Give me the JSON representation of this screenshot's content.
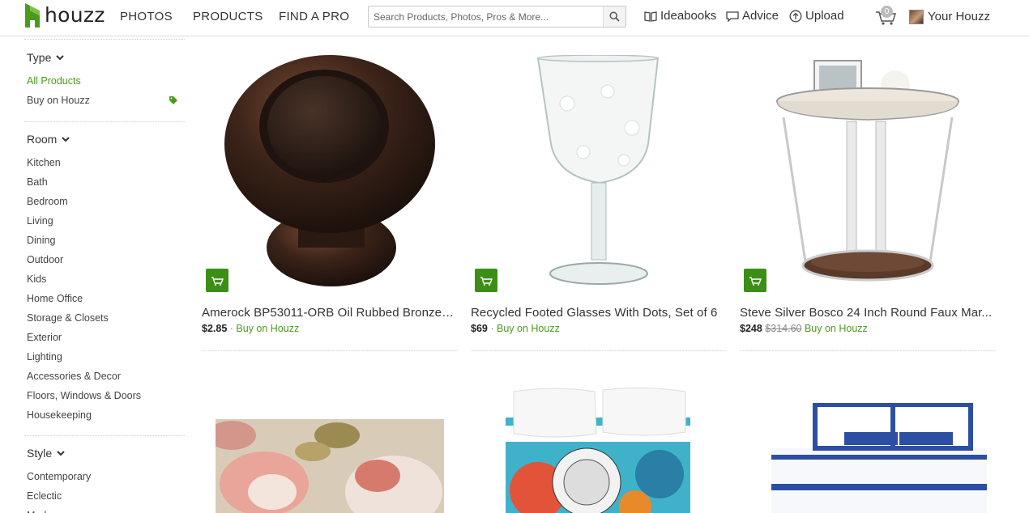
{
  "brand": {
    "name": "houzz",
    "accent": "#4a9b1b"
  },
  "nav": {
    "photos": "PHOTOS",
    "products": "PRODUCTS",
    "find_a_pro": "FIND A PRO"
  },
  "search": {
    "placeholder": "Search Products, Photos, Pros & More..."
  },
  "header_links": {
    "ideabooks": "Ideabooks",
    "advice": "Advice",
    "upload": "Upload",
    "cart_count": "0",
    "your_houzz": "Your Houzz"
  },
  "sidebar": {
    "type": {
      "title": "Type",
      "items": [
        "All Products",
        "Buy on Houzz"
      ]
    },
    "room": {
      "title": "Room",
      "items": [
        "Kitchen",
        "Bath",
        "Bedroom",
        "Living",
        "Dining",
        "Outdoor",
        "Kids",
        "Home Office",
        "Storage & Closets",
        "Exterior",
        "Lighting",
        "Accessories & Decor",
        "Floors, Windows & Doors",
        "Housekeeping"
      ]
    },
    "style": {
      "title": "Style",
      "items": [
        "Contemporary",
        "Eclectic",
        "Modern"
      ]
    }
  },
  "products": [
    {
      "title": "Amerock BP53011-ORB Oil Rubbed Bronze ...",
      "price": "$2.85",
      "old_price": "",
      "link": "Buy on Houzz"
    },
    {
      "title": "Recycled Footed Glasses With Dots, Set of 6",
      "price": "$69",
      "old_price": "",
      "link": "Buy on Houzz"
    },
    {
      "title": "Steve Silver Bosco 24 Inch Round Faux Mar...",
      "price": "$248",
      "old_price": "$314.60",
      "link": "Buy on Houzz"
    }
  ]
}
